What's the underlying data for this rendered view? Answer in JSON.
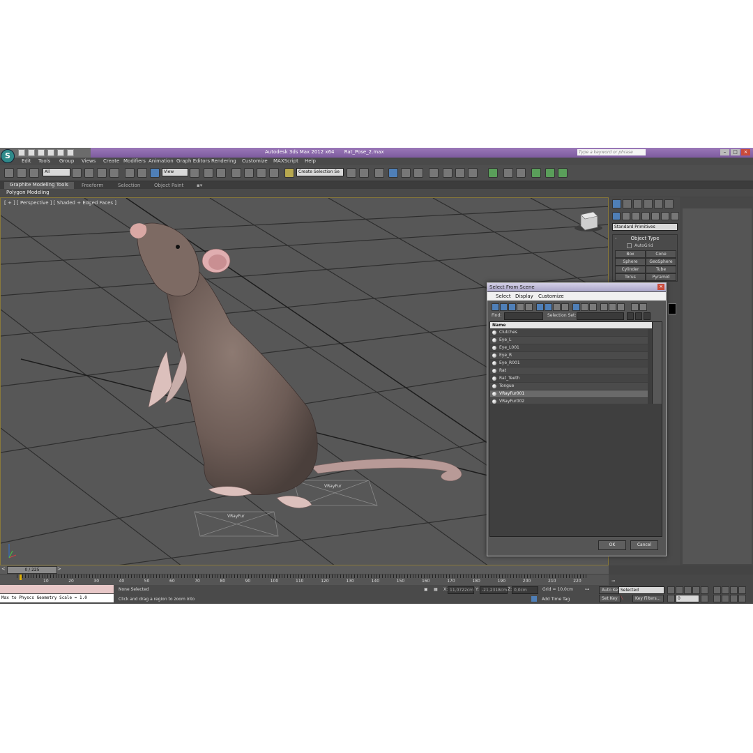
{
  "window": {
    "app_title": "Autodesk 3ds Max  2012 x64",
    "file_name": "Rat_Pose_2.max",
    "search_placeholder": "Type a keyword or phrase",
    "logo_letter": "S"
  },
  "menu": [
    "Edit",
    "Tools",
    "Group",
    "Views",
    "Create",
    "Modifiers",
    "Animation",
    "Graph Editors",
    "Rendering",
    "Customize",
    "MAXScript",
    "Help"
  ],
  "toolbar": {
    "selection_filter": "All",
    "reference_coord": "View",
    "named_selection": "Create Selection Se"
  },
  "ribbon": {
    "tabs": [
      "Graphite Modeling Tools",
      "Freeform",
      "Selection",
      "Object Paint"
    ],
    "panel_label": "Polygon Modeling"
  },
  "viewport": {
    "label": "[ + ] [ Perspective ] [ Shaded + Edged Faces ]",
    "vrayfur_labels": [
      "VRayFur",
      "VRayFur"
    ]
  },
  "command_panel": {
    "category": "Standard Primitives",
    "rollout_title": "Object Type",
    "autogrid": "AutoGrid",
    "primitives": [
      "Box",
      "Cone",
      "Sphere",
      "GeoSphere",
      "Cylinder",
      "Tube",
      "Torus",
      "Pyramid"
    ]
  },
  "dialog": {
    "title": "Select From Scene",
    "menu": [
      "Select",
      "Display",
      "Customize"
    ],
    "find_label": "Find:",
    "selection_set_label": "Selection Set:",
    "column_name": "Name",
    "items": [
      "Clutches",
      "Eye_L",
      "Eye_L001",
      "Eye_R",
      "Eye_R001",
      "Rat",
      "Rat_Teeth",
      "Tongue",
      "VRayFur001",
      "VRayFur002"
    ],
    "highlighted_item": "VRayFur001",
    "ok_label": "OK",
    "cancel_label": "Cancel"
  },
  "timeline": {
    "slider_label": "0 / 225",
    "ticks": [
      "10",
      "20",
      "30",
      "40",
      "50",
      "60",
      "70",
      "80",
      "90",
      "100",
      "110",
      "120",
      "130",
      "140",
      "150",
      "160",
      "170",
      "180",
      "190",
      "200",
      "210",
      "220"
    ]
  },
  "status": {
    "maxscript_output": "Max to Physcs Geometry Scale = 1.0",
    "selection_status": "None Selected",
    "prompt": "Click and drag a region to zoom into",
    "x_label": "X:",
    "x_value": "11,0722cm",
    "y_label": "Y:",
    "y_value": "-21,2318cm",
    "z_label": "Z:",
    "z_value": "0,0cm",
    "grid": "Grid = 10,0cm",
    "add_time_tag": "Add Time Tag"
  },
  "animation": {
    "auto_key": "Auto Key",
    "set_key": "Set Key",
    "key_mode": "Selected",
    "key_filters": "Key Filters...",
    "frame": "0"
  },
  "colors": {
    "titlebar": "#8a68ab",
    "viewport_bg": "#575757",
    "accent": "#4f7fb7"
  }
}
